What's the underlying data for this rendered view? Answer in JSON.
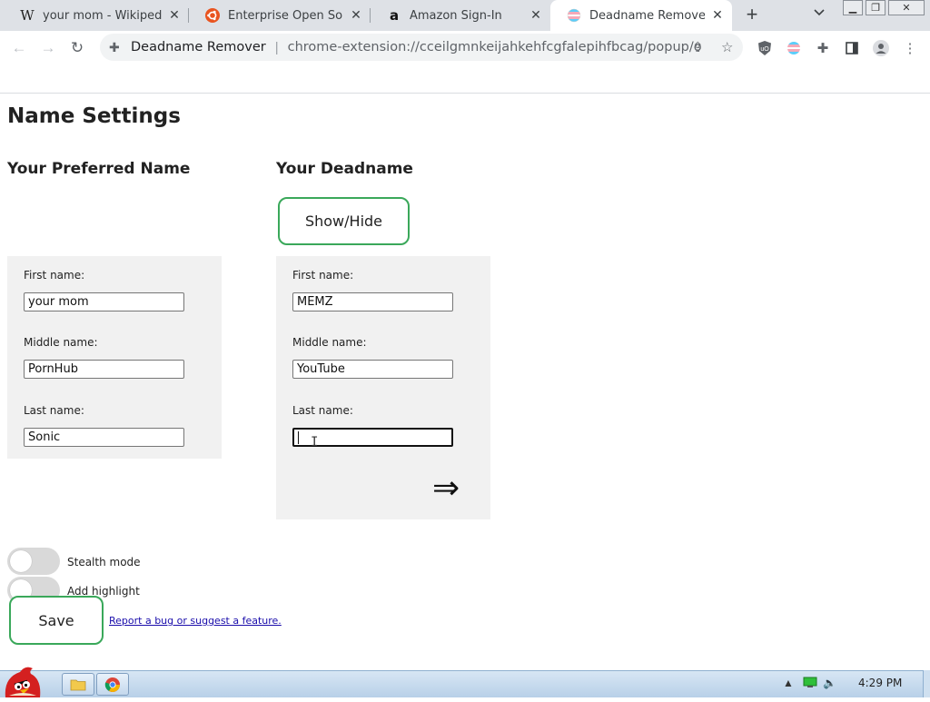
{
  "browser": {
    "tabs": [
      {
        "title": "your mom - Wikipedia",
        "favicon": "wikipedia-icon",
        "active": false
      },
      {
        "title": "Enterprise Open Source",
        "favicon": "ubuntu-icon",
        "active": false
      },
      {
        "title": "Amazon Sign-In",
        "favicon": "amazon-icon",
        "active": false
      },
      {
        "title": "Deadname Remover Op",
        "favicon": "trans-flag-icon",
        "active": true
      }
    ],
    "site_name": "Deadname Remover",
    "url": "chrome-extension://cceilgmnkeijahkehfcgfalepihfbcag/popup/opt..."
  },
  "page": {
    "title": "Name Settings",
    "preferred": {
      "heading": "Your Preferred Name",
      "first_label": "First name:",
      "first_value": "your mom",
      "middle_label": "Middle name:",
      "middle_value": "PornHub",
      "last_label": "Last name:",
      "last_value": "Sonic"
    },
    "deadname": {
      "heading": "Your Deadname",
      "show_hide_label": "Show/Hide",
      "first_label": "First name:",
      "first_value": "MEMZ",
      "middle_label": "Middle name:",
      "middle_value": "YouTube",
      "last_label": "Last name:",
      "last_value": "",
      "arrow": "⇒"
    },
    "options": {
      "stealth_label": "Stealth mode",
      "stealth_on": false,
      "highlight_label": "Add highlight",
      "highlight_on": false
    },
    "save_label": "Save",
    "bug_link": "Report a bug or suggest a feature."
  },
  "taskbar": {
    "clock": "4:29 PM"
  },
  "colors": {
    "accent_green": "#3aa85a",
    "panel_bg": "#f1f1f1",
    "link": "#1a0dab"
  }
}
